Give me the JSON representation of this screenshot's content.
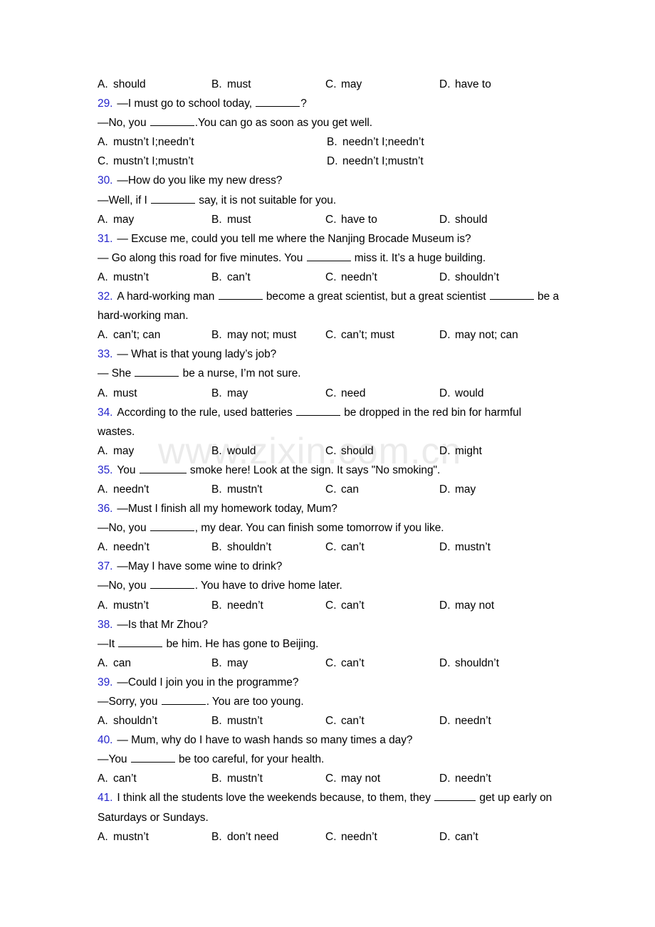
{
  "document": {
    "watermark": "www.zixin.com.cn",
    "accent_blue": "#2525cc",
    "watermark_color": "#ebebeb"
  },
  "top_options": {
    "a_label": "A.",
    "a_text": "should",
    "b_label": "B.",
    "b_text": "must",
    "c_label": "C.",
    "c_text": "may",
    "d_label": "D.",
    "d_text": "have to"
  },
  "questions": [
    {
      "num": "29.",
      "stem1_a": "—I must go to school today, ",
      "stem1_b": "?",
      "stem2_a": "—No, you ",
      "stem2_b": ".You can go as soon as you get well.",
      "layout": "c2",
      "options": [
        {
          "label": "A.",
          "text": "mustn’t I;needn’t"
        },
        {
          "label": "B.",
          "text": "needn’t I;needn’t"
        },
        {
          "label": "C.",
          "text": "mustn’t I;mustn’t"
        },
        {
          "label": "D.",
          "text": "needn’t I;mustn’t"
        }
      ]
    },
    {
      "num": "30.",
      "stem1_a": "—How do you like my new dress?",
      "stem2_a": "—Well, if I ",
      "stem2_b": " say, it is not suitable for you.",
      "layout": "c4",
      "options": [
        {
          "label": "A.",
          "text": "may"
        },
        {
          "label": "B.",
          "text": "must"
        },
        {
          "label": "C.",
          "text": "have to"
        },
        {
          "label": "D.",
          "text": "should"
        }
      ]
    },
    {
      "num": "31.",
      "stem1_a": "— Excuse me, could you tell me where the Nanjing Brocade Museum is?",
      "stem2_a": "— Go along this road for five minutes. You ",
      "stem2_b": " miss it. It’s a huge building.",
      "layout": "c4",
      "options": [
        {
          "label": "A.",
          "text": "mustn’t"
        },
        {
          "label": "B.",
          "text": "can’t"
        },
        {
          "label": "C.",
          "text": "needn’t"
        },
        {
          "label": "D.",
          "text": "shouldn’t"
        }
      ]
    },
    {
      "num": "32.",
      "stem1_a": "A hard-working man ",
      "stem1_b": " become a great scientist, but a great scientist ",
      "stem1_c": " be a",
      "stem1_wrap": "hard-working man.",
      "layout": "c4",
      "options": [
        {
          "label": "A.",
          "text": "can’t; can"
        },
        {
          "label": "B.",
          "text": "may not; must"
        },
        {
          "label": "C.",
          "text": "can’t; must"
        },
        {
          "label": "D.",
          "text": "may not; can"
        }
      ]
    },
    {
      "num": "33.",
      "stem1_a": "— What is that young lady’s job?",
      "stem2_a": "— She ",
      "stem2_b": " be a nurse, I’m not sure.",
      "layout": "c4",
      "options": [
        {
          "label": "A.",
          "text": "must"
        },
        {
          "label": "B.",
          "text": "may"
        },
        {
          "label": "C.",
          "text": "need"
        },
        {
          "label": "D.",
          "text": "would"
        }
      ]
    },
    {
      "num": "34.",
      "stem1_a": "According to the rule, used batteries ",
      "stem1_b": " be dropped in the red bin for harmful",
      "stem1_wrap": "wastes.",
      "layout": "c4",
      "options": [
        {
          "label": "A.",
          "text": "may"
        },
        {
          "label": "B.",
          "text": "would"
        },
        {
          "label": "C.",
          "text": "should"
        },
        {
          "label": "D.",
          "text": "might"
        }
      ]
    },
    {
      "num": "35.",
      "stem1_a": "You ",
      "stem1_b": " smoke here! Look at the sign. It says \"No smoking\".",
      "layout": "c4",
      "options": [
        {
          "label": "A.",
          "text": "needn't"
        },
        {
          "label": "B.",
          "text": "mustn't"
        },
        {
          "label": "C.",
          "text": "can"
        },
        {
          "label": "D.",
          "text": "may"
        }
      ]
    },
    {
      "num": "36.",
      "stem1_a": "—Must I finish all my homework today, Mum?",
      "stem2_a": "—No, you ",
      "stem2_b": ", my dear. You can finish some tomorrow if you like.",
      "layout": "c4",
      "options": [
        {
          "label": "A.",
          "text": "needn’t"
        },
        {
          "label": "B.",
          "text": "shouldn’t"
        },
        {
          "label": "C.",
          "text": "can’t"
        },
        {
          "label": "D.",
          "text": "mustn’t"
        }
      ]
    },
    {
      "num": "37.",
      "stem1_a": "—May I have some wine to drink?",
      "stem2_a": "—No, you ",
      "stem2_b": ". You have to drive home later.",
      "layout": "c4",
      "options": [
        {
          "label": "A.",
          "text": "mustn’t"
        },
        {
          "label": "B.",
          "text": "needn’t"
        },
        {
          "label": "C.",
          "text": "can’t"
        },
        {
          "label": "D.",
          "text": "may not"
        }
      ]
    },
    {
      "num": "38.",
      "stem1_a": "—Is that Mr Zhou?",
      "stem2_a": "—It ",
      "stem2_b": " be him. He has gone to Beijing.",
      "layout": "c4",
      "options": [
        {
          "label": "A.",
          "text": "can"
        },
        {
          "label": "B.",
          "text": "may"
        },
        {
          "label": "C.",
          "text": "can’t"
        },
        {
          "label": "D.",
          "text": "shouldn’t"
        }
      ]
    },
    {
      "num": "39.",
      "stem1_a": "—Could I join you in the programme?",
      "stem2_a": "—Sorry, you ",
      "stem2_b": ". You are too young.",
      "layout": "c4",
      "options": [
        {
          "label": "A.",
          "text": "shouldn’t"
        },
        {
          "label": "B.",
          "text": "mustn’t"
        },
        {
          "label": "C.",
          "text": "can’t"
        },
        {
          "label": "D.",
          "text": "needn’t"
        }
      ]
    },
    {
      "num": "40.",
      "stem1_a": "— Mum, why do I have to wash hands so many times a day?",
      "stem2_a": "—You ",
      "stem2_b": " be too careful, for your health.",
      "layout": "c4",
      "options": [
        {
          "label": "A.",
          "text": "can’t"
        },
        {
          "label": "B.",
          "text": "mustn’t"
        },
        {
          "label": "C.",
          "text": "may not"
        },
        {
          "label": "D.",
          "text": "needn’t"
        }
      ]
    },
    {
      "num": "41.",
      "stem1_a": "I think all the students love the weekends because, to them, they ",
      "stem1_b": " get up early on",
      "stem1_wrap": "Saturdays or Sundays.",
      "layout": "c4",
      "options": [
        {
          "label": "A.",
          "text": "mustn’t"
        },
        {
          "label": "B.",
          "text": "don’t need"
        },
        {
          "label": "C.",
          "text": "needn’t"
        },
        {
          "label": "D.",
          "text": "can’t"
        }
      ]
    }
  ]
}
